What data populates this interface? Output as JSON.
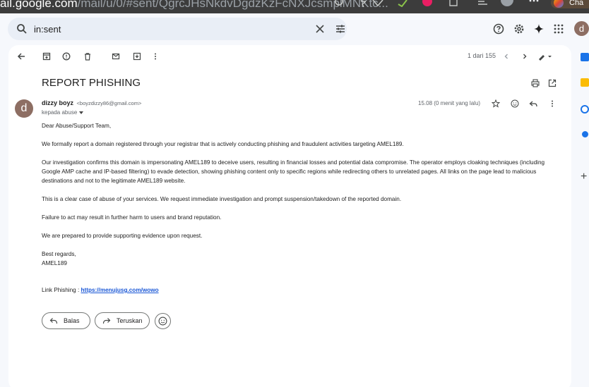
{
  "browser": {
    "url_host": "ail.google.com",
    "url_path": "/mail/u/0/#sent/QgrcJHsNkdvDgdzKzFcNXJcsmplMNKtc...",
    "profile_label": "Cha"
  },
  "search": {
    "value": "in:sent"
  },
  "header": {
    "avatar_letter": "d"
  },
  "toolbar": {
    "pager": "1 dari 155"
  },
  "email": {
    "subject": "REPORT PHISHING",
    "sender_name": "dizzy boyz",
    "sender_email": "<boyzdizzy86@gmail.com>",
    "recipient_label": "kepada abuse",
    "timestamp": "15.08 (0 menit yang lalu)",
    "avatar_letter": "d",
    "greeting": "Dear Abuse/Support Team,",
    "paragraph_1": "We formally report a domain registered through your registrar that is actively conducting phishing and fraudulent activities targeting AMEL189.",
    "paragraph_2": "Our investigation confirms this domain is impersonating AMEL189 to deceive users, resulting in financial losses and potential data compromise. The operator employs cloaking techniques (including Google AMP cache and IP-based filtering) to evade detection, showing phishing content only to specific regions while redirecting others to unrelated pages. All links on the page lead to malicious destinations and not to the legitimate AMEL189 website.",
    "paragraph_3": "This is a clear case of abuse of your services. We request immediate investigation and prompt suspension/takedown of the reported domain.",
    "paragraph_4": "Failure to act may result in further harm to users and brand reputation.",
    "paragraph_5": "We are prepared to provide supporting evidence upon request.",
    "signoff": "Best regards,",
    "signature": "AMEL189",
    "link_label": "Link Phishing : ",
    "link_url": "https://menujusg.com/wowo"
  },
  "actions": {
    "reply_label": "Balas",
    "forward_label": "Teruskan"
  },
  "colors": {
    "background": "#f6f8fc",
    "avatar": "#8d6e63",
    "link": "#1a57d6"
  }
}
